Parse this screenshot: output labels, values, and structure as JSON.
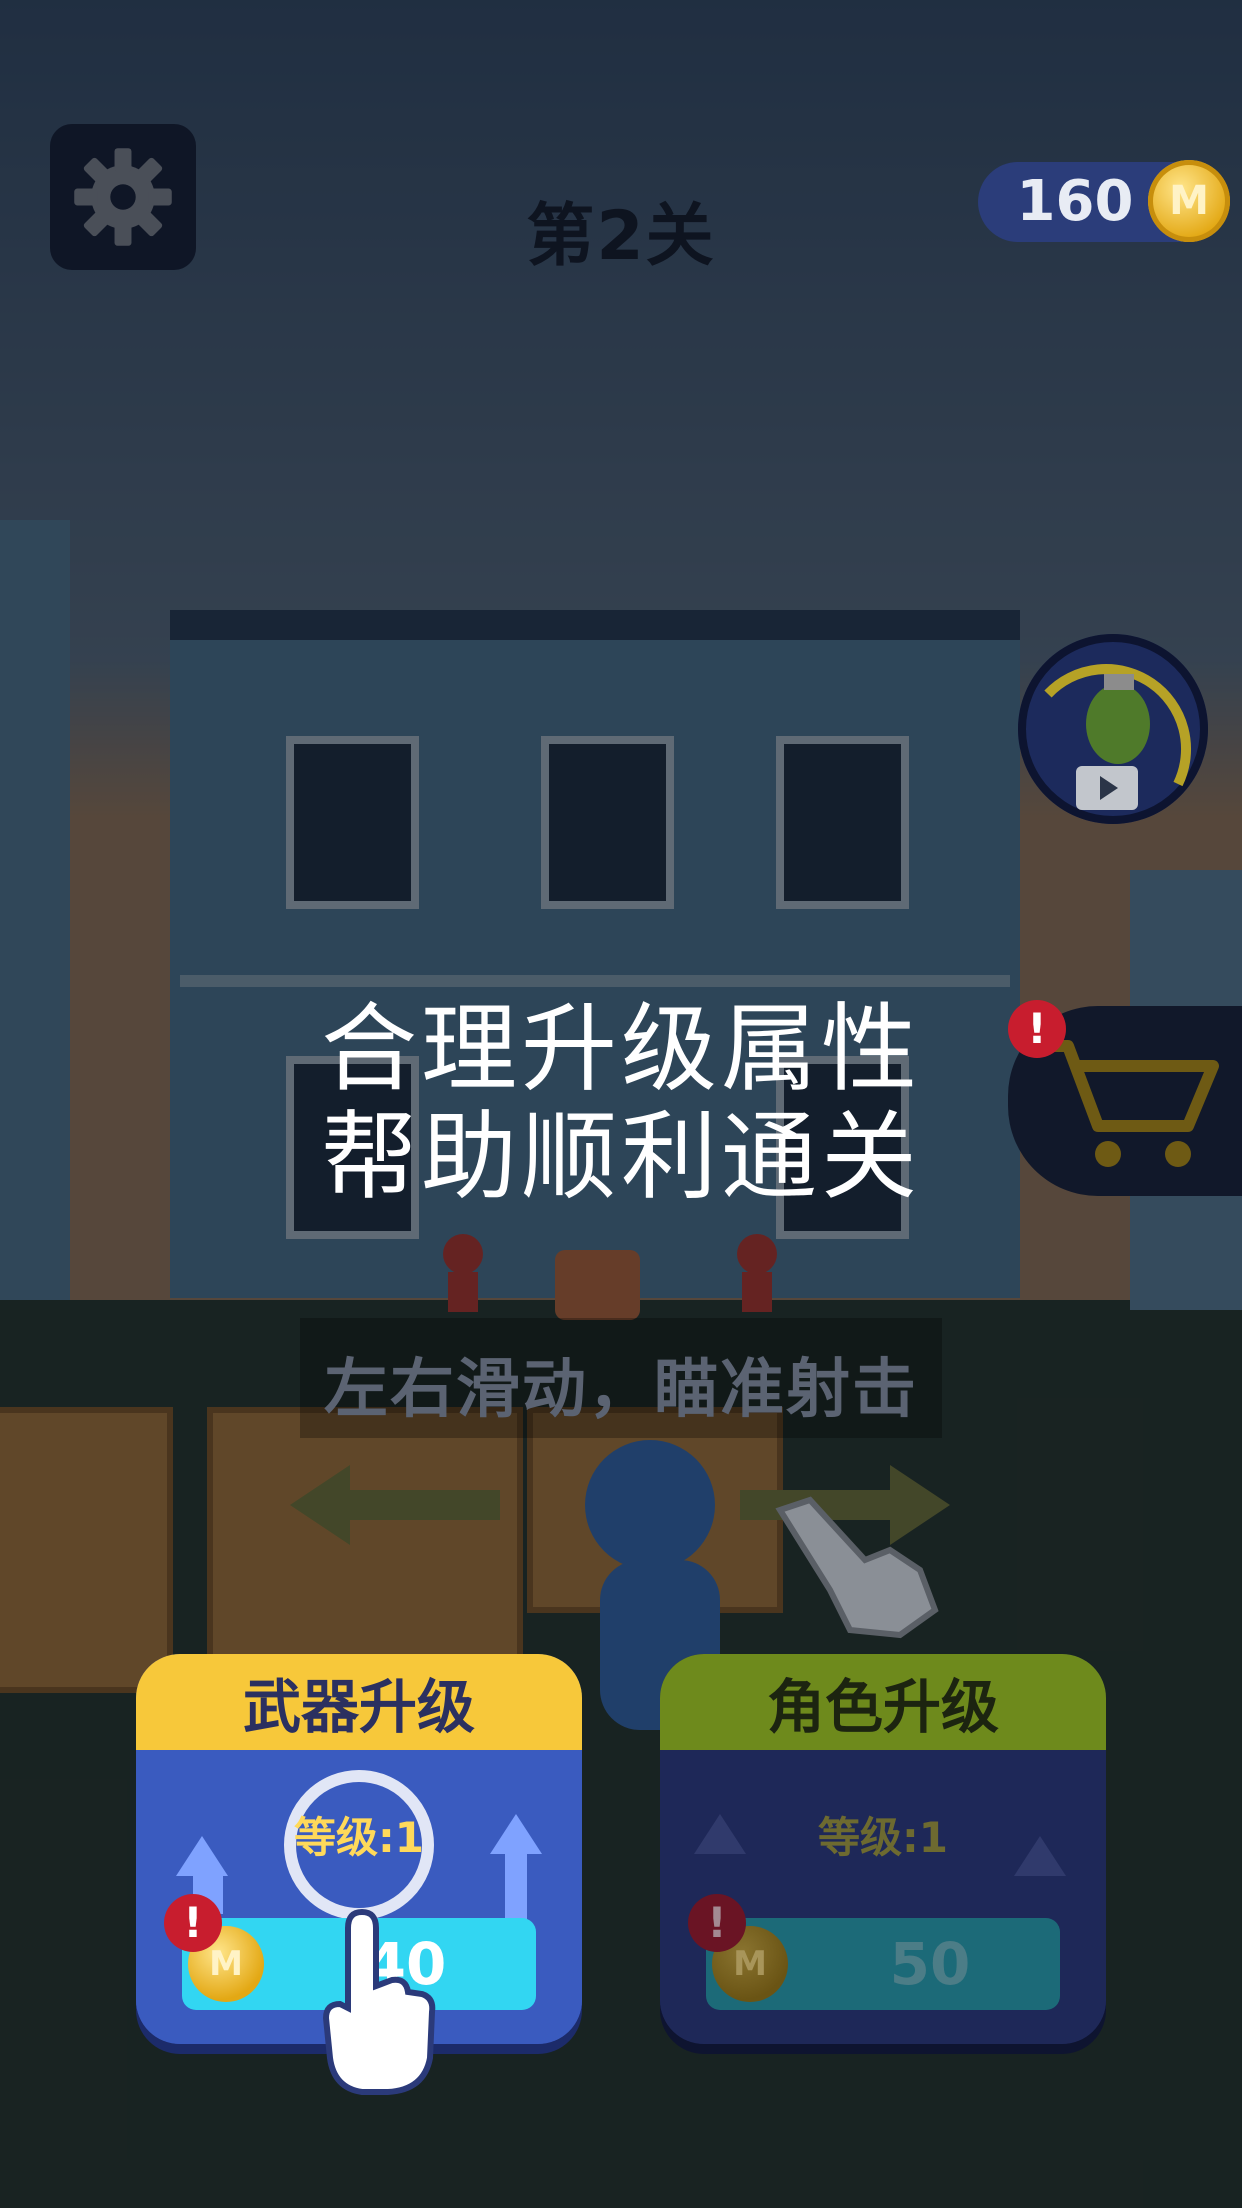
{
  "top_bar": {
    "settings_icon": "gear-icon",
    "level_title": "第2关",
    "coins": "160",
    "coin_symbol": "M"
  },
  "side_buttons": {
    "grenade_icon": "grenade-video-icon",
    "cart_icon": "shopping-cart-icon",
    "alert_mark": "!"
  },
  "tutorial": {
    "hint_line1": "合理升级属性",
    "hint_line2": "帮助顺利通关",
    "swipe_hint": "左右滑动，瞄准射击"
  },
  "upgrades": {
    "weapon": {
      "title": "武器升级",
      "level": "等级:1",
      "price": "40",
      "alert": "!"
    },
    "character": {
      "title": "角色升级",
      "level": "等级:1",
      "price": "50",
      "alert": "!"
    }
  },
  "colors": {
    "accent_yellow": "#f7c83a",
    "card_blue": "#3450a8",
    "price_cyan": "#2fd4ef",
    "alert_red": "#d6213a"
  }
}
